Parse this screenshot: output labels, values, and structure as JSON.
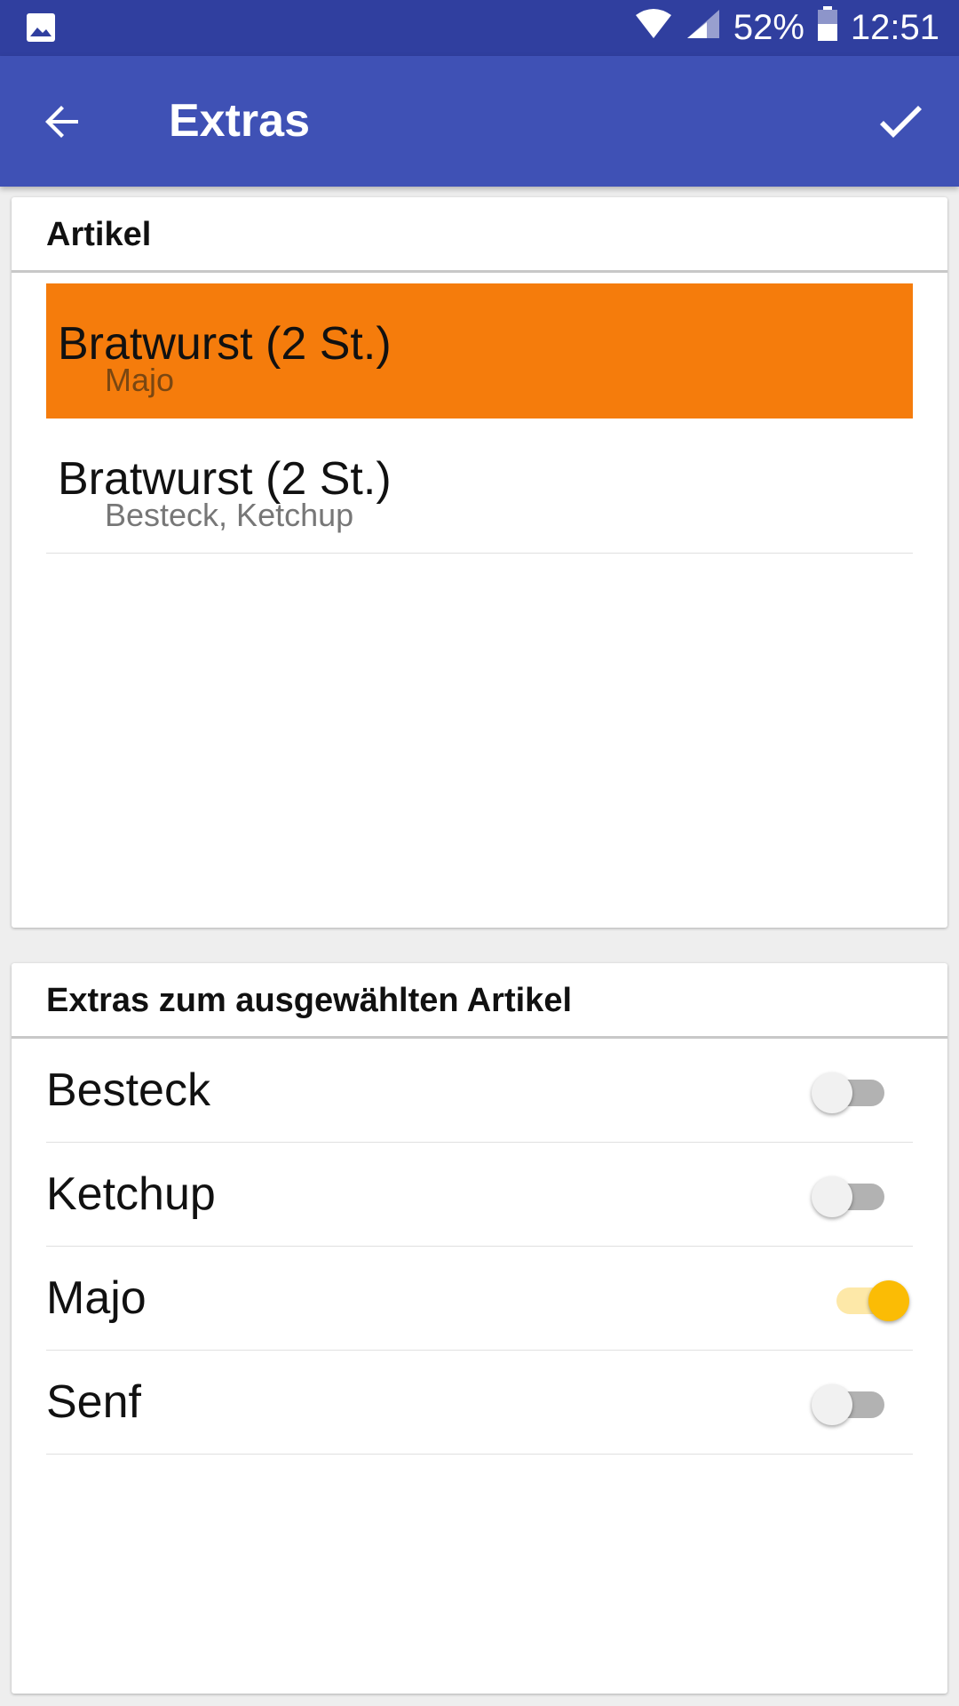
{
  "status_bar": {
    "battery": "52%",
    "time": "12:51"
  },
  "app_bar": {
    "title": "Extras",
    "back_icon": "arrow-back-icon",
    "confirm_icon": "check-icon"
  },
  "articles": {
    "header": "Artikel",
    "items": [
      {
        "name": "Bratwurst (2 St.)",
        "extras": "Majo",
        "selected": true
      },
      {
        "name": "Bratwurst (2 St.)",
        "extras": "Besteck, Ketchup",
        "selected": false
      }
    ]
  },
  "extras": {
    "header": "Extras zum ausgewählten Artikel",
    "items": [
      {
        "label": "Besteck",
        "checked": false
      },
      {
        "label": "Ketchup",
        "checked": false
      },
      {
        "label": "Majo",
        "checked": true
      },
      {
        "label": "Senf",
        "checked": false
      }
    ]
  },
  "colors": {
    "status_bar": "#303f9f",
    "app_bar": "#3f51b5",
    "selected_row": "#f57c0c",
    "switch_on": "#fbbc05"
  }
}
